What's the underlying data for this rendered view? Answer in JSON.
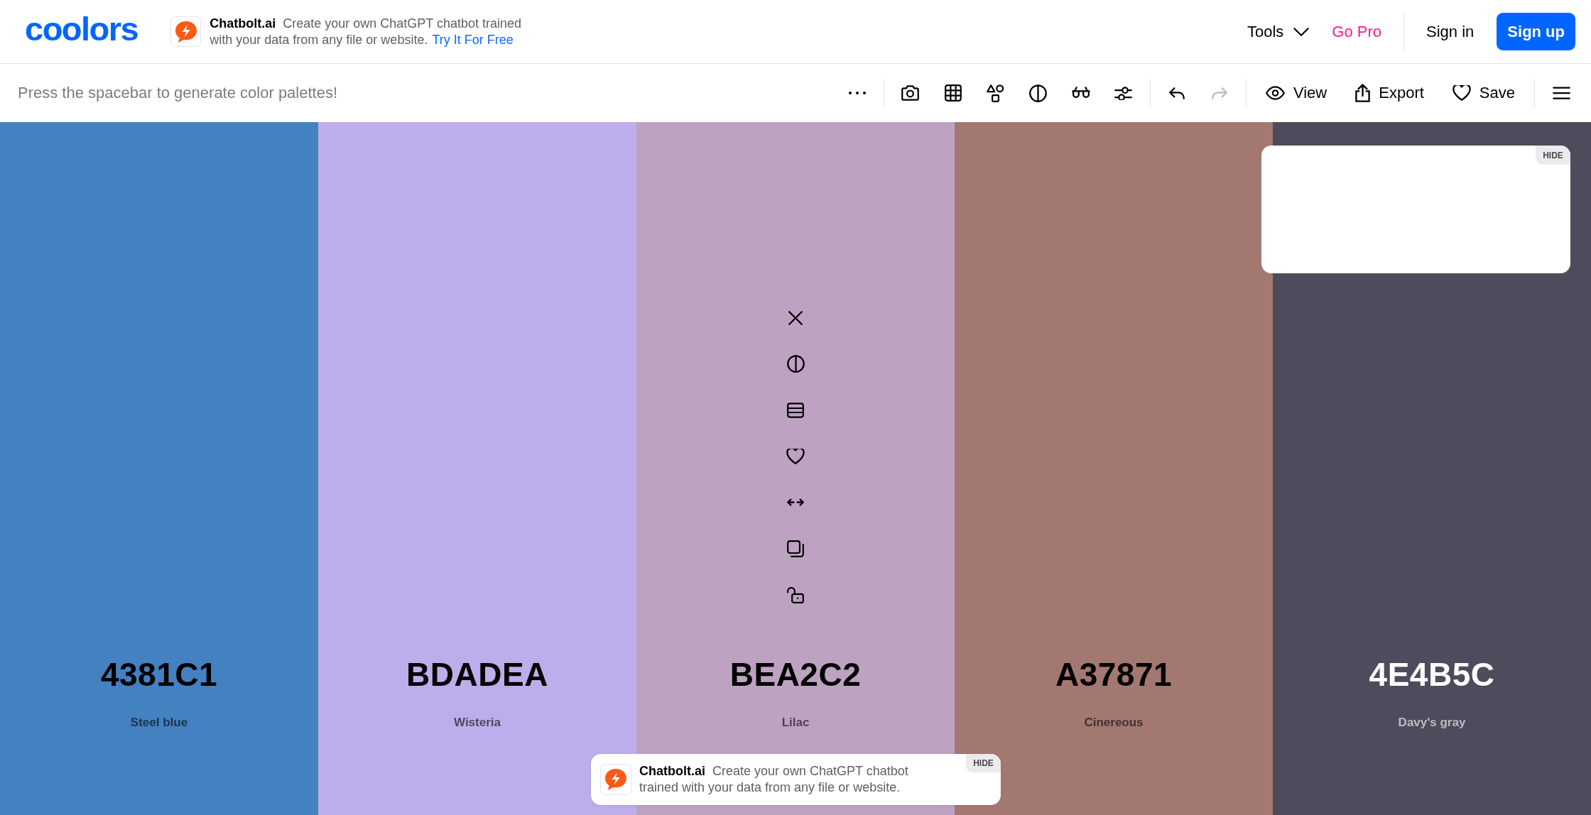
{
  "header": {
    "logo": "coolors",
    "ad": {
      "text": "**Chatbolt.ai** Create your own ChatGPT chatbot trained with your data from any file or website.",
      "link": "Try It For Free"
    },
    "nav": [
      {
        "kind": "menu",
        "label": "Tools"
      },
      {
        "kind": "promo",
        "label": "Go Pro"
      }
    ],
    "account": [
      {
        "kind": "link",
        "label": "Sign in"
      },
      {
        "kind": "primary",
        "label": "Sign up"
      }
    ]
  },
  "toolbar": {
    "hint": "Press the spacebar to generate color palettes!",
    "groups": [
      [
        {
          "kind": "more",
          "disabled": false
        }
      ],
      [
        {
          "kind": "image",
          "disabled": false
        },
        {
          "kind": "grid",
          "disabled": false
        },
        {
          "kind": "shapes",
          "disabled": false
        },
        {
          "kind": "contrast",
          "disabled": false
        },
        {
          "kind": "glasses",
          "disabled": false
        },
        {
          "kind": "adjust",
          "disabled": false
        }
      ],
      [
        {
          "kind": "undo",
          "disabled": false
        },
        {
          "kind": "redo",
          "disabled": true
        }
      ],
      [
        {
          "kind": "view",
          "label": "View",
          "disabled": false
        },
        {
          "kind": "export",
          "label": "Export",
          "disabled": false
        },
        {
          "kind": "save",
          "label": "Save",
          "disabled": false
        }
      ],
      [
        {
          "kind": "menu",
          "disabled": false
        }
      ]
    ]
  },
  "colors": [
    {
      "hex": "4381C1",
      "name": "Steel blue",
      "color": "#4381c1",
      "hovered": false,
      "locked": false
    },
    {
      "hex": "BDADEA",
      "name": "Wisteria",
      "color": "#bdadea",
      "hovered": false,
      "locked": false
    },
    {
      "hex": "BEA2C2",
      "name": "Lilac",
      "color": "#bea2c2",
      "hovered": true,
      "locked": false
    },
    {
      "hex": "A37871",
      "name": "Cinereous",
      "color": "#a37871",
      "hovered": false,
      "locked": false
    },
    {
      "hex": "4E4B5C",
      "name": "Davy's gray",
      "color": "#4e4b5c",
      "hovered": false,
      "locked": false
    }
  ],
  "ad_panel": {
    "hide": "HIDE"
  },
  "ad_banner": {
    "text": "**Chatbolt.ai** Create your own ChatGPT chatbot trained with your data from any file or website.",
    "hide": "HIDE"
  }
}
